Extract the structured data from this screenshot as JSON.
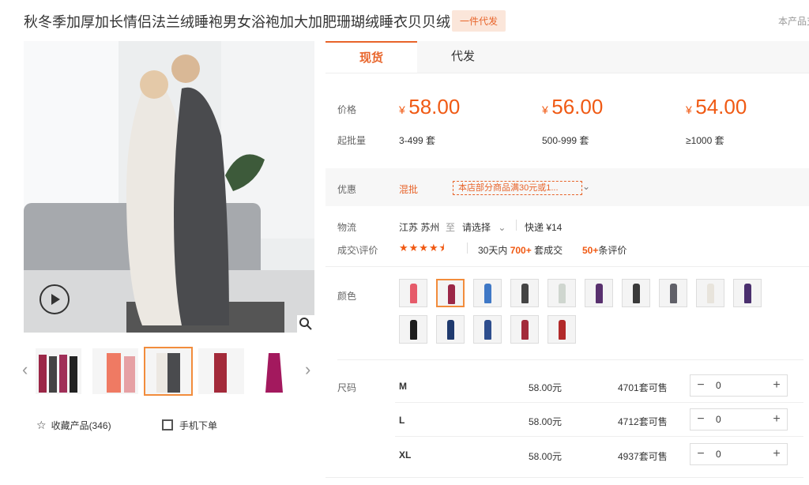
{
  "header": {
    "title": "秋冬季加厚加长情侣法兰绒睡袍男女浴袍加大加肥珊瑚绒睡衣贝贝绒",
    "badge": "一件代发",
    "right_text": "本产品支"
  },
  "gallery": {
    "favorites_label": "收藏产品(346)",
    "mobile_label": "手机下单"
  },
  "tabs": [
    {
      "label": "现货"
    },
    {
      "label": "代发"
    }
  ],
  "pricing": {
    "price_label": "价格",
    "moq_label": "起批量",
    "currency": "¥",
    "tiers": [
      {
        "price": "58.00",
        "range": "3-499",
        "unit": "套"
      },
      {
        "price": "56.00",
        "range": "500-999",
        "unit": "套"
      },
      {
        "price": "54.00",
        "range": "≥1000",
        "unit": "套"
      }
    ]
  },
  "discount": {
    "label": "优惠",
    "mix_label": "混批",
    "promo_text": "本店部分商品满30元或1..."
  },
  "logistics": {
    "label": "物流",
    "from": "江苏 苏州",
    "to_word": "至",
    "select": "请选择",
    "express": "快递 ¥14"
  },
  "deals": {
    "label": "成交\\评价",
    "rating": 4.5,
    "prefix": "30天内",
    "count": "700+",
    "count_suffix": "套成交",
    "reviews": "50+",
    "reviews_suffix": "条评价"
  },
  "colors": {
    "label": "颜色",
    "swatches": [
      "#e65b6a",
      "#9b2747",
      "#3f78c6",
      "#444444",
      "#cfd6cf",
      "#58306e",
      "#3a3a3a",
      "#606068",
      "#e8e4dc",
      "#4a2f6e",
      "#1d1d1d",
      "#1f3a6e",
      "#2e4e8e",
      "#a32a3a",
      "#b22a2a"
    ]
  },
  "sizes": {
    "label": "尺码",
    "rows": [
      {
        "size": "M",
        "price": "58.00元",
        "stock": "4701套可售",
        "qty": "0"
      },
      {
        "size": "L",
        "price": "58.00元",
        "stock": "4712套可售",
        "qty": "0"
      },
      {
        "size": "XL",
        "price": "58.00元",
        "stock": "4937套可售",
        "qty": "0"
      }
    ]
  },
  "stepper": {
    "minus": "−",
    "plus": "+"
  }
}
